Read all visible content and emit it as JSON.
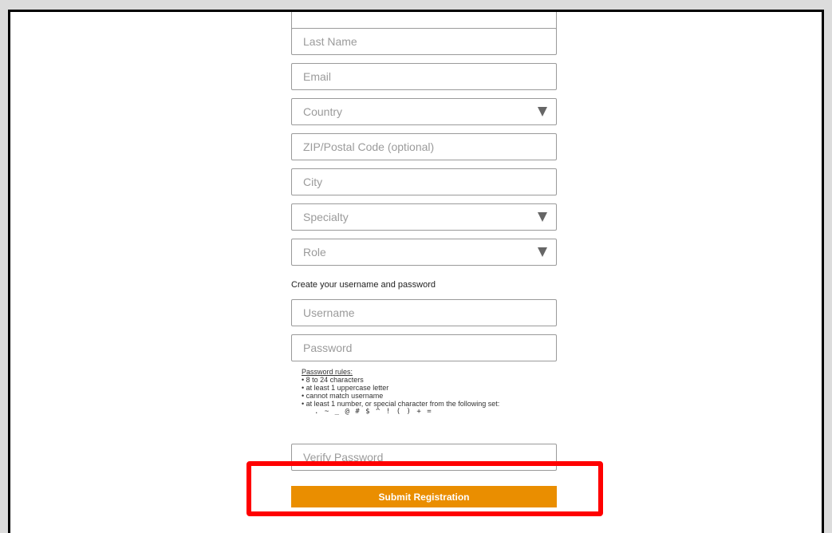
{
  "form": {
    "last_name_placeholder": "Last Name",
    "email_placeholder": "Email",
    "country_placeholder": "Country",
    "zip_placeholder": "ZIP/Postal Code (optional)",
    "city_placeholder": "City",
    "specialty_placeholder": "Specialty",
    "role_placeholder": "Role",
    "credentials_label": "Create your username and password",
    "username_placeholder": "Username",
    "password_placeholder": "Password",
    "password_rules": {
      "title": "Password rules:",
      "items": [
        "• 8 to 24 characters",
        "• at least 1 uppercase letter",
        "• cannot match username",
        "• at least 1 number, or special character from the following set:"
      ],
      "special_chars": ". ~ _ @ # $ ^ ! ( ) + ="
    },
    "verify_password_placeholder": "Verify Password",
    "submit_label": "Submit Registration"
  },
  "colors": {
    "submit_bg": "#ea8e00",
    "highlight": "#ff0000"
  },
  "icons": {
    "dropdown": "chevron-down-icon"
  }
}
